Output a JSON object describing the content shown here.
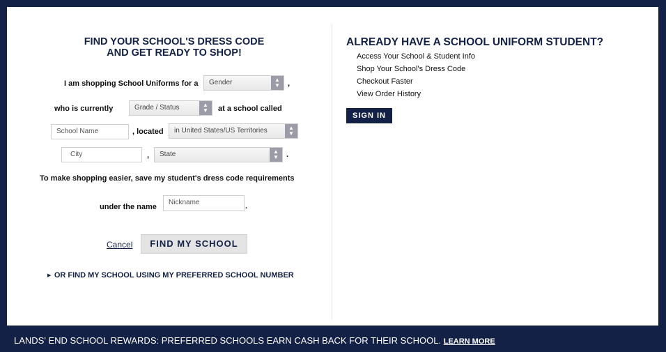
{
  "find": {
    "heading_line1": "FIND YOUR SCHOOL'S DRESS CODE",
    "heading_line2": "AND GET READY TO SHOP!",
    "shopping_for_label": "I am shopping School Uniforms for a",
    "gender_value": "Gender",
    "comma1": ",",
    "currently_label": "who is currently",
    "grade_value": "Grade / Status",
    "school_called_label": "at a school called",
    "school_name_placeholder": "School Name",
    "located_label": ", located",
    "location_value": "in United States/US Territories",
    "city_placeholder": "City",
    "comma2": ",",
    "state_value": "State",
    "period1": ".",
    "save_label": "To make shopping easier, save my student's dress code requirements",
    "under_name_label": "under the name",
    "nickname_placeholder": "Nickname",
    "period2": ".",
    "cancel_label": "Cancel",
    "find_button_label": "FIND MY SCHOOL",
    "preferred_link": "OR FIND MY SCHOOL USING MY PREFERRED SCHOOL NUMBER"
  },
  "account": {
    "title": "ALREADY HAVE A SCHOOL UNIFORM STUDENT?",
    "items": [
      "Access Your School & Student Info",
      "Shop Your School's Dress Code",
      "Checkout Faster",
      "View Order History"
    ],
    "signin_label": "SIGN IN"
  },
  "footer": {
    "text": "LANDS' END SCHOOL REWARDS: PREFERRED SCHOOLS EARN CASH BACK FOR THEIR SCHOOL.",
    "learn_more": "LEARN MORE"
  },
  "colors": {
    "navy": "#142146",
    "white": "#ffffff",
    "input_border": "#cfcfcf"
  },
  "icons": {
    "select_arrows": "up-down-arrows-icon",
    "preferred_caret": "triangle-right-icon"
  }
}
